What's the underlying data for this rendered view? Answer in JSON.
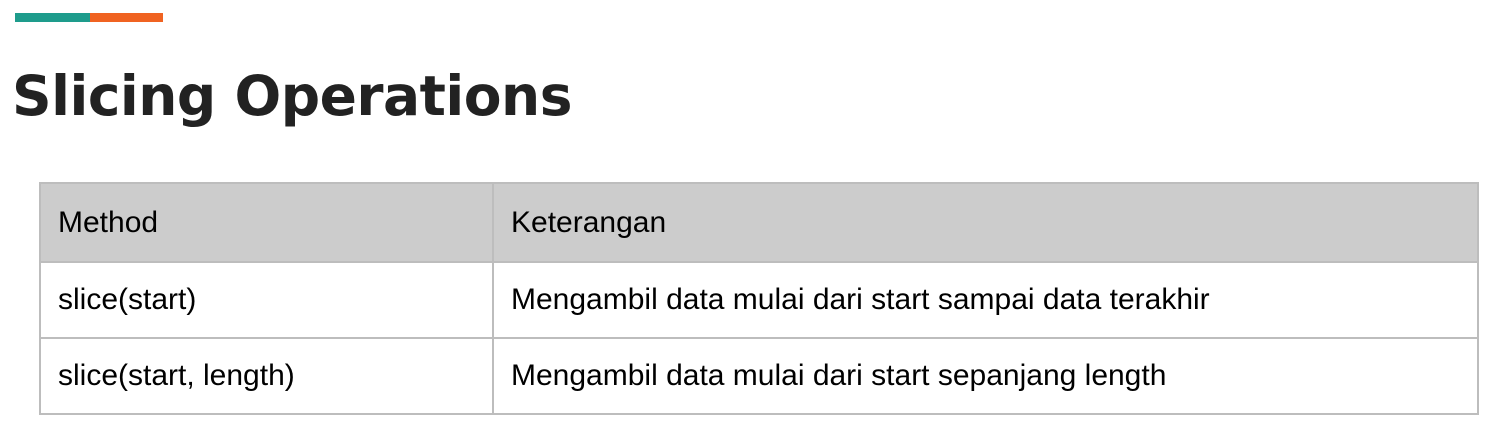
{
  "title": "Slicing Operations",
  "colors": {
    "accent_teal": "#1e9c8c",
    "accent_orange": "#f06321",
    "header_bg": "#cccccc",
    "border": "#bdbdbd",
    "title_text": "#222222"
  },
  "table": {
    "headers": [
      "Method",
      "Keterangan"
    ],
    "rows": [
      [
        "slice(start)",
        "Mengambil data mulai dari start sampai data terakhir"
      ],
      [
        "slice(start, length)",
        "Mengambil data mulai dari start sepanjang length"
      ]
    ]
  }
}
